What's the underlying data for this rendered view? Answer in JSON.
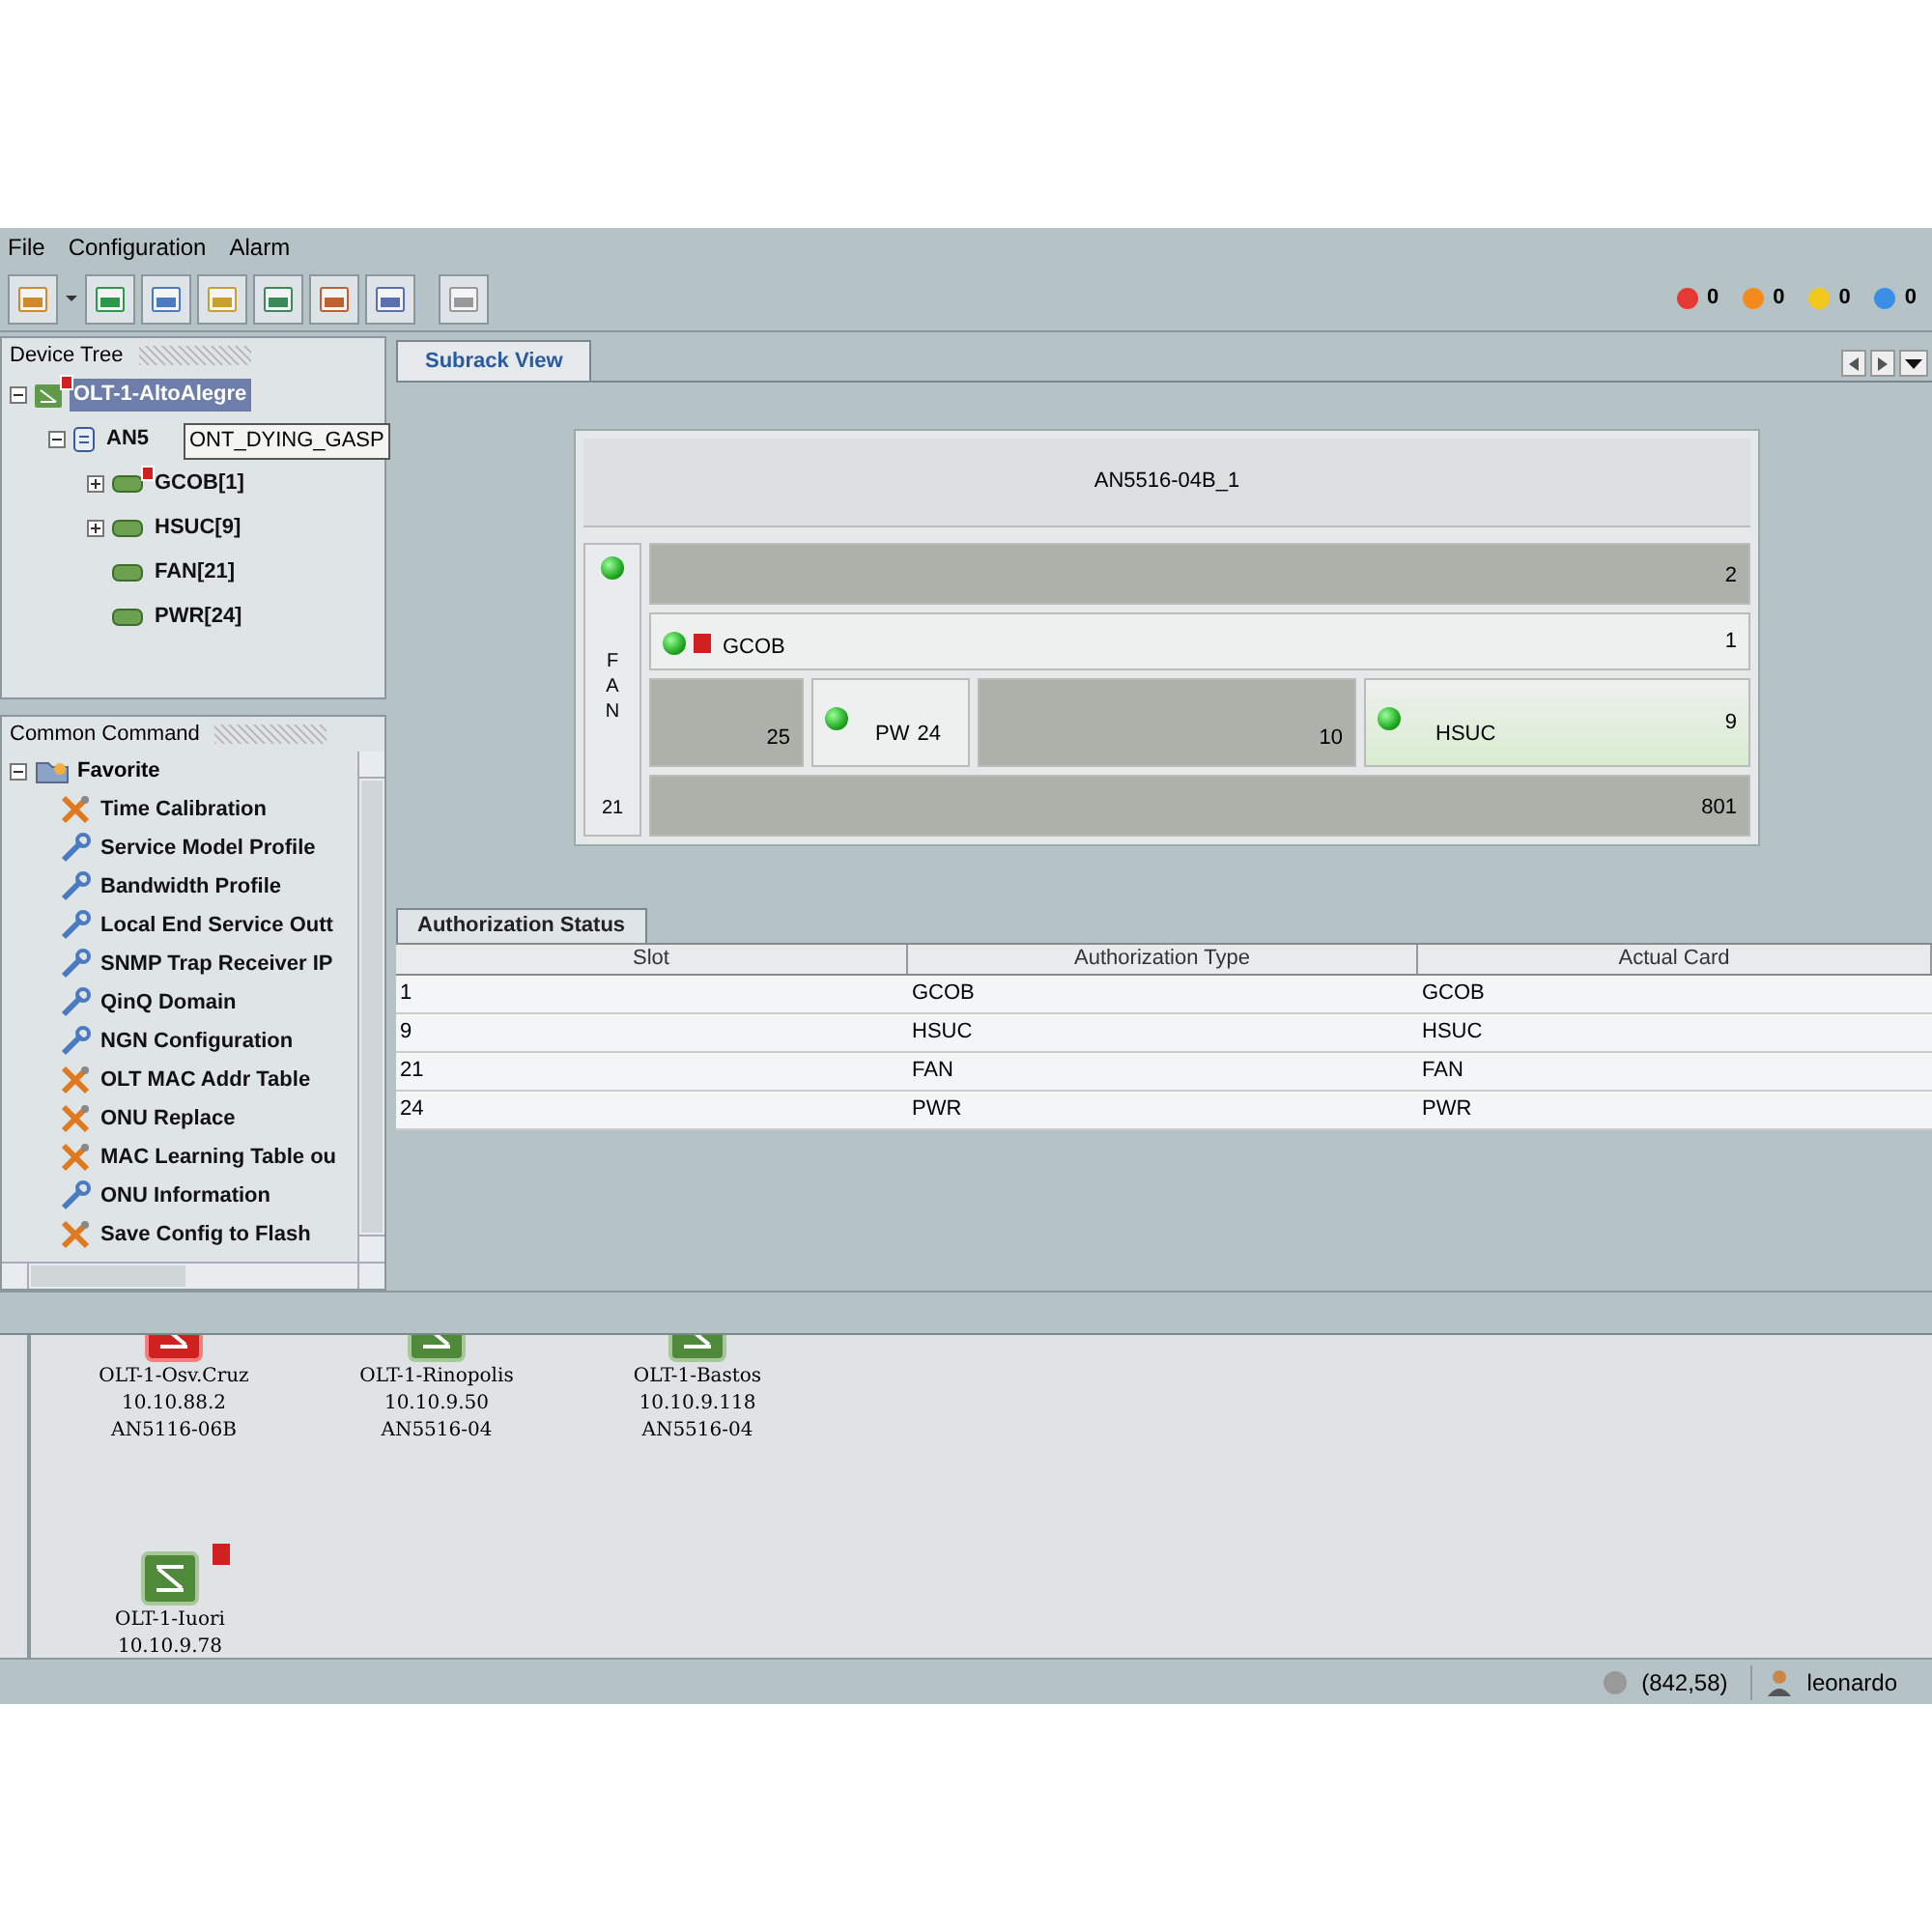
{
  "menu": [
    "File",
    "Configuration",
    "Alarm"
  ],
  "alarm_counters": [
    {
      "color": "#e53935",
      "count": "0"
    },
    {
      "color": "#f28a1e",
      "count": "0"
    },
    {
      "color": "#f2c81e",
      "count": "0"
    },
    {
      "color": "#3a8ee6",
      "count": "0"
    }
  ],
  "device_tree": {
    "title": "Device Tree",
    "items": [
      {
        "label": "OLT-1-AltoAlegre",
        "selected": true,
        "alarm": true,
        "expanded": true,
        "kind": "olt",
        "children": [
          {
            "label": "AN5",
            "selected": false,
            "alarm": false,
            "expanded": true,
            "kind": "shelf",
            "children": [
              {
                "label": "GCOB[1]",
                "selected": false,
                "alarm": true,
                "expanded": false,
                "kind": "card"
              },
              {
                "label": "HSUC[9]",
                "selected": false,
                "alarm": false,
                "expanded": false,
                "kind": "card"
              },
              {
                "label": "FAN[21]",
                "selected": false,
                "alarm": false,
                "kind": "card"
              },
              {
                "label": "PWR[24]",
                "selected": false,
                "alarm": false,
                "kind": "card"
              }
            ]
          }
        ]
      }
    ],
    "tooltip": "ONT_DYING_GASP"
  },
  "common_command": {
    "title": "Common Command",
    "root": {
      "label": "Favorite",
      "expanded": true
    },
    "items": [
      {
        "label": "Time Calibration",
        "kind": "tools"
      },
      {
        "label": "Service Model Profile",
        "kind": "wrench"
      },
      {
        "label": "Bandwidth Profile",
        "kind": "wrench"
      },
      {
        "label": "Local End Service Outt",
        "kind": "wrench"
      },
      {
        "label": "SNMP Trap Receiver IP",
        "kind": "wrench"
      },
      {
        "label": "QinQ Domain",
        "kind": "wrench"
      },
      {
        "label": "NGN Configuration",
        "kind": "wrench"
      },
      {
        "label": "OLT MAC Addr Table",
        "kind": "tools"
      },
      {
        "label": "ONU Replace",
        "kind": "tools"
      },
      {
        "label": "MAC Learning Table ou",
        "kind": "tools"
      },
      {
        "label": "ONU Information",
        "kind": "wrench"
      },
      {
        "label": "Save Config to Flash",
        "kind": "tools"
      }
    ]
  },
  "tabs": [
    {
      "label": "Subrack View",
      "selected": true
    }
  ],
  "subrack": {
    "title": "AN5516-04B_1",
    "fan": {
      "letters": [
        "F",
        "A",
        "N"
      ],
      "slot": "21",
      "led": true
    },
    "rows": [
      [
        {
          "slot": "2",
          "kind": "empty"
        }
      ],
      [
        {
          "slot": "1",
          "kind": "card",
          "name": "GCOB",
          "led": true,
          "alarm": true
        }
      ],
      [
        {
          "slot": "25",
          "kind": "empty"
        },
        {
          "slot": "24",
          "kind": "power",
          "name": "PW",
          "led": true,
          "alarm": false
        },
        {
          "slot": "10",
          "kind": "empty"
        },
        {
          "slot": "9",
          "kind": "card",
          "name": "HSUC",
          "led": true,
          "alarm": false
        }
      ],
      [
        {
          "slot": "801",
          "kind": "empty"
        }
      ]
    ]
  },
  "authorization": {
    "tab": "Authorization Status",
    "columns": [
      "Slot",
      "Authorization Type",
      "Actual Card"
    ],
    "rows": [
      [
        "1",
        "GCOB",
        "GCOB"
      ],
      [
        "9",
        "HSUC",
        "HSUC"
      ],
      [
        "21",
        "FAN",
        "FAN"
      ],
      [
        "24",
        "PWR",
        "PWR"
      ]
    ]
  },
  "topology": [
    {
      "name": "OLT-1-Osv.Cruz",
      "ip": "10.10.88.2",
      "model": "AN5116-06B",
      "kind": "alarm"
    },
    {
      "name": "OLT-1-Rinopolis",
      "ip": "10.10.9.50",
      "model": "AN5516-04",
      "kind": "normal"
    },
    {
      "name": "OLT-1-Bastos",
      "ip": "10.10.9.118",
      "model": "AN5516-04",
      "kind": "normal"
    },
    {
      "name": "OLT-1-Iuori",
      "ip": "10.10.9.78",
      "kind": "normal",
      "alarm": true
    }
  ],
  "status_bar": {
    "coordinates": "(842,58)",
    "user": "leonardo"
  }
}
